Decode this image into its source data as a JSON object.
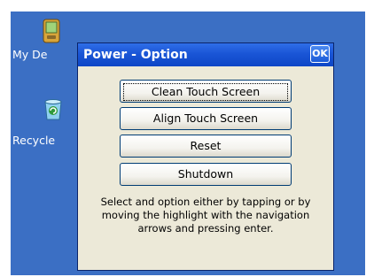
{
  "desktop": {
    "background": "#3b6fc4",
    "icons": [
      {
        "label": "My De",
        "icon": "my-device-icon"
      },
      {
        "label": "Recycle",
        "icon": "recycle-bin-icon"
      }
    ]
  },
  "dialog": {
    "title": "Power - Option",
    "ok_label": "OK",
    "buttons": [
      {
        "label": "Clean Touch Screen",
        "focused": true
      },
      {
        "label": "Align Touch Screen"
      },
      {
        "label": "Reset"
      },
      {
        "label": "Shutdown"
      }
    ],
    "description": "Select and option either by tapping or by moving the highlight with the navigation arrows and pressing enter."
  },
  "colors": {
    "titlebar": "#1a55d6",
    "dialog_bg": "#ece9d8",
    "button_border": "#003c74"
  }
}
